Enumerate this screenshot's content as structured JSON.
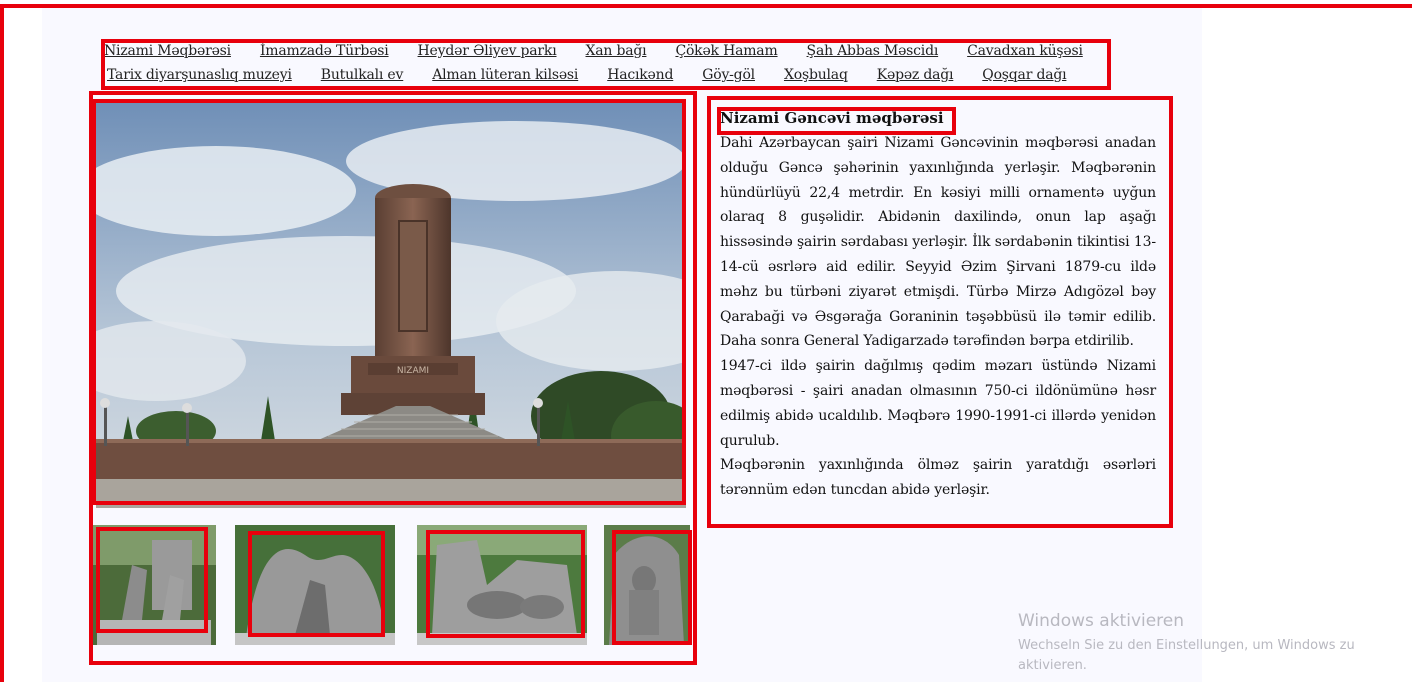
{
  "nav": {
    "row1": [
      "Nizami Məqbərəsi",
      "İmamzadə Türbəsi",
      "Heydər Əliyev parkı",
      "Xan bağı",
      "Çökək Hamam",
      "Şah Abbas Məscidı",
      "Cavadxan küşəsi"
    ],
    "row2": [
      "Tarix diyarşunaslıq muzeyi",
      "Butulkalı ev",
      "Alman lüteran kilsəsi",
      "Hacıkənd",
      "Göy-göl",
      "Xoşbulaq",
      "Kəpəz dağı",
      "Qoşqar dağı"
    ]
  },
  "gallery": {
    "main_photo_text": "NIZAMI",
    "thumbnails": [
      "statue-scene-1",
      "statue-scene-2",
      "statue-scene-3",
      "statue-scene-4"
    ]
  },
  "article": {
    "title": "Nizami Gəncəvi məqbərəsi",
    "paragraphs": [
      "Dahi Azərbaycan şairi Nizami Gəncəvinin məqbərəsi anadan olduğu Gəncə şəhərinin yaxınlığında yerləşir. Məqbərənin hündürlüyü 22,4 metrdir. En kəsiyi milli ornamentə uyğun olaraq 8 guşəlidir. Abidənin daxilində, onun lap aşağı hissəsində şairin sərdabası yerləşir. İlk sərdabənin tikintisi 13-14-cü əsrlərə aid edilir. Seyyid Əzim Şirvani 1879-cu ildə məhz bu türbəni ziyarət etmişdi. Türbə Mirzə Adıgözəl bəy Qarabaği və Əsgərağa Goraninin təşəbbüsü ilə təmir edilib. Daha sonra General Yadigarzadə tərəfindən bərpa etdirilib.",
      "1947-ci ildə şairin dağılmış qədim məzarı üstündə Nizami məqbərəsi - şairi anadan olmasının 750-ci ildönümünə həsr edilmiş abidə ucaldılıb. Məqbərə 1990-1991-ci illərdə yenidən qurulub.",
      "Məqbərənin yaxınlığında ölməz şairin yaratdığı əsərləri tərənnüm edən tuncdan abidə yerləşir."
    ]
  },
  "windows_watermark": {
    "title": "Windows aktivieren",
    "subtitle": "Wechseln Sie zu den Einstellungen, um Windows zu aktivieren."
  },
  "colors": {
    "highlight": "#e8000c",
    "page_background": "#f9f9ff"
  }
}
